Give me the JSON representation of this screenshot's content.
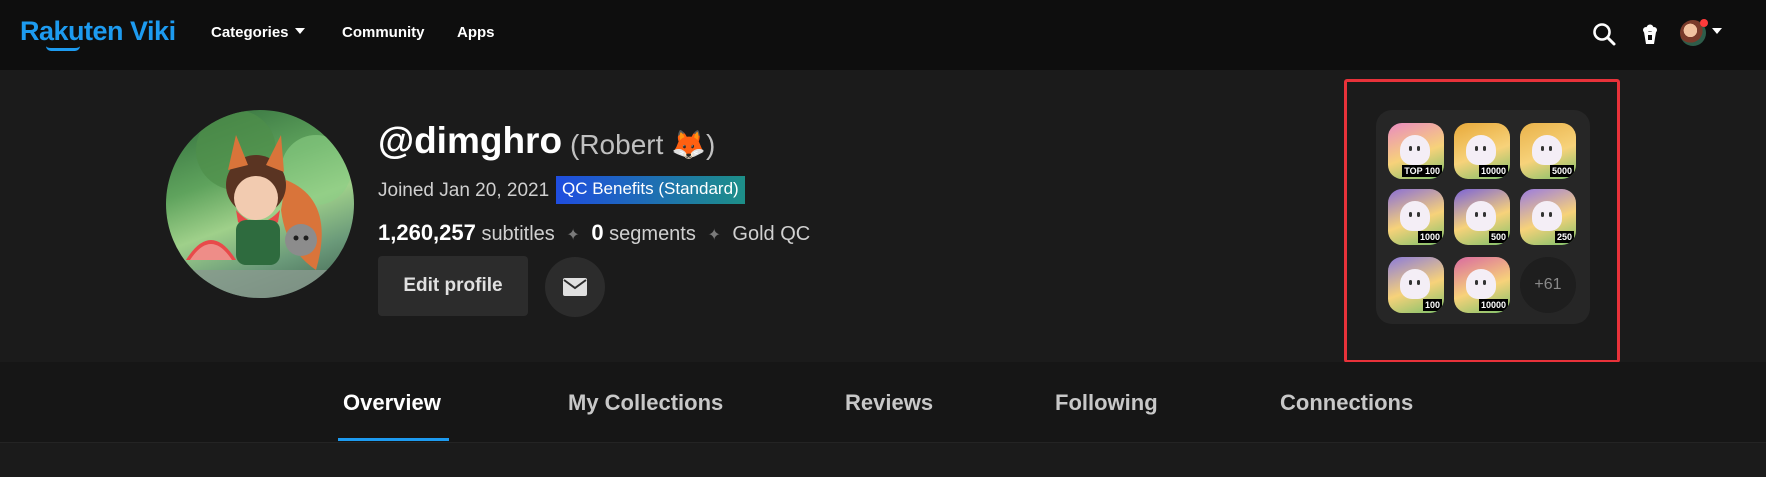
{
  "header": {
    "logo": "Rakuten Viki",
    "nav": [
      "Categories",
      "Community",
      "Apps"
    ]
  },
  "profile": {
    "handle": "@dimghro",
    "display_name": "(Robert 🦊)",
    "joined": "Joined Jan 20, 2021",
    "qc_badge": "QC Benefits (Standard)",
    "subtitles_count": "1,260,257",
    "subtitles_label": "subtitles",
    "segments_count": "0",
    "segments_label": "segments",
    "rank": "Gold QC",
    "separator": "✦",
    "edit_button": "Edit profile"
  },
  "badges": {
    "items": [
      {
        "label": "TOP 100",
        "bg": "#e98bc0"
      },
      {
        "label": "10000",
        "bg": "#e8a93a"
      },
      {
        "label": "5000",
        "bg": "#e9b24a"
      },
      {
        "label": "1000",
        "bg": "#8a6fd6"
      },
      {
        "label": "500",
        "bg": "#7b63d8"
      },
      {
        "label": "250",
        "bg": "#9a7be0"
      },
      {
        "label": "100",
        "bg": "#8b7bdb"
      },
      {
        "label": "10000",
        "bg": "#d96aa0"
      }
    ],
    "more": "+61"
  },
  "tabs": [
    "Overview",
    "My Collections",
    "Reviews",
    "Following",
    "Connections"
  ],
  "colors": {
    "accent": "#1d9bf0",
    "highlight_border": "#e8323a"
  }
}
